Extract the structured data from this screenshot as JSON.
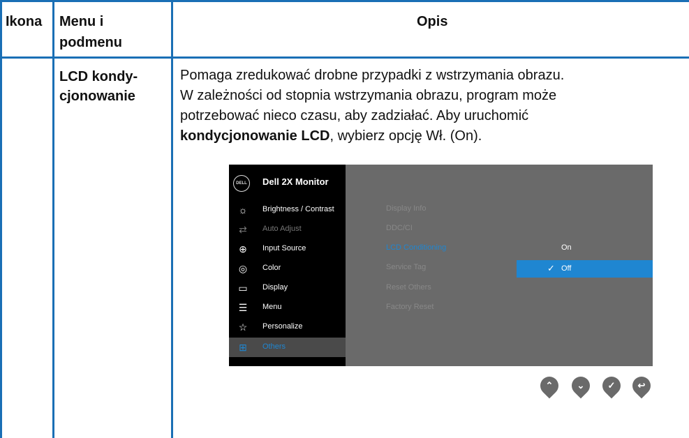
{
  "table": {
    "headers": {
      "icon": "Ikona",
      "menu": "Menu i\npodmenu",
      "desc": "Opis"
    },
    "row": {
      "menu_label": "LCD kondy-\ncjonowanie",
      "description": {
        "line1": "Pomaga zredukować drobne przypadki z wstrzymania obrazu.",
        "line2": "W zależności od stopnia wstrzymania obrazu, program może",
        "line3": "potrzebować nieco czasu, aby zadziałać. Aby uruchomić",
        "bold": "kondycjonowanie LCD",
        "line4_rest": ", wybierz opcję Wł. (On)."
      }
    }
  },
  "osd": {
    "logo": "DELL",
    "title": "Dell 2X Monitor",
    "menu_items": [
      {
        "label": "Brightness / Contrast",
        "icon": "brightness-icon",
        "state": "normal"
      },
      {
        "label": "Auto Adjust",
        "icon": "auto-adjust-icon",
        "state": "dim"
      },
      {
        "label": "Input Source",
        "icon": "input-source-icon",
        "state": "normal"
      },
      {
        "label": "Color",
        "icon": "color-icon",
        "state": "normal"
      },
      {
        "label": "Display",
        "icon": "display-icon",
        "state": "normal"
      },
      {
        "label": "Menu",
        "icon": "menu-icon",
        "state": "normal"
      },
      {
        "label": "Personalize",
        "icon": "star-icon",
        "state": "normal"
      },
      {
        "label": "Others",
        "icon": "others-icon",
        "state": "selected"
      }
    ],
    "submenu": [
      {
        "label": "Display Info",
        "active": false
      },
      {
        "label": "DDC/CI",
        "active": false
      },
      {
        "label": "LCD Conditioning",
        "active": true
      },
      {
        "label": "Service Tag",
        "active": false
      },
      {
        "label": "Reset Others",
        "active": false
      },
      {
        "label": "Factory Reset",
        "active": false
      }
    ],
    "options": [
      {
        "label": "On",
        "selected": false
      },
      {
        "label": "Off",
        "selected": true
      }
    ],
    "nav_buttons": [
      {
        "name": "up-arrow-icon",
        "glyph": "^"
      },
      {
        "name": "down-arrow-icon",
        "glyph": "v"
      },
      {
        "name": "check-icon",
        "glyph": "✓"
      },
      {
        "name": "back-icon",
        "glyph": "↩"
      }
    ]
  },
  "colors": {
    "rule": "#1a6fb5",
    "osd_accent": "#1f86d1",
    "osd_panel": "#6a6a6a"
  }
}
